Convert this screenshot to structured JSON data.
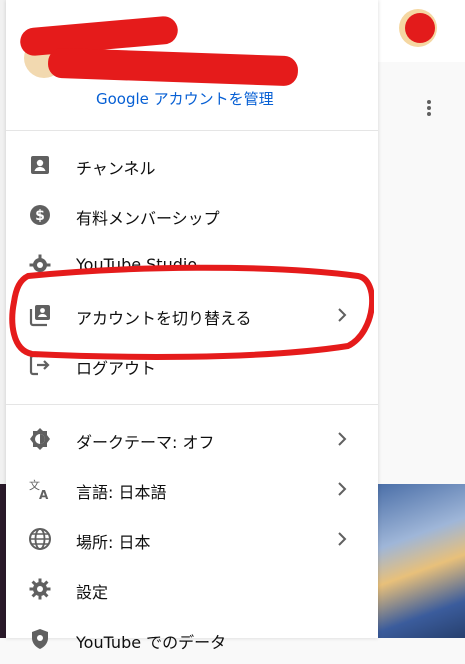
{
  "account": {
    "manage_link": "Google アカウントを管理"
  },
  "menu": {
    "items": [
      {
        "label": "チャンネル",
        "icon": "person-box-icon"
      },
      {
        "label": "有料メンバーシップ",
        "icon": "dollar-circle-icon"
      },
      {
        "label": "YouTube Studio",
        "icon": "gear-icon"
      },
      {
        "label": "アカウントを切り替える",
        "icon": "switch-account-icon",
        "submenu": true
      },
      {
        "label": "ログアウト",
        "icon": "logout-icon"
      },
      {
        "label": "ダークテーマ: オフ",
        "icon": "dark-theme-icon",
        "submenu": true
      },
      {
        "label": "言語: 日本語",
        "icon": "translate-icon",
        "submenu": true
      },
      {
        "label": "場所: 日本",
        "icon": "globe-icon",
        "submenu": true
      },
      {
        "label": "設定",
        "icon": "settings-icon"
      },
      {
        "label": "YouTube でのデータ",
        "icon": "shield-icon"
      }
    ]
  },
  "colors": {
    "link": "#065fd4",
    "annotation": "#e51b1b",
    "icon": "#606060"
  }
}
